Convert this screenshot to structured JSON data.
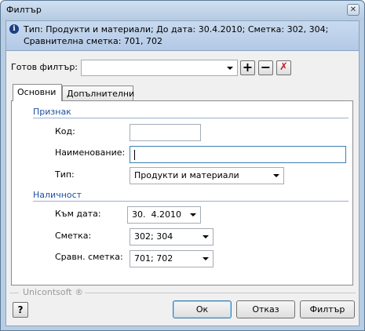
{
  "window": {
    "title": "Филтър",
    "close_glyph": "✕"
  },
  "info": {
    "icon": "i",
    "text": "Тип: Продукти и материали; До дата: 30.4.2010; Сметка: 302, 304; Сравнителна сметка: 701, 702"
  },
  "ready_filter": {
    "label": "Готов филтър:",
    "value": ""
  },
  "toolbar": {
    "add_glyph": "+",
    "remove_glyph": "−",
    "clear_glyph": "✗"
  },
  "tabs": [
    {
      "label": "Основни",
      "active": true
    },
    {
      "label": "Допълнителни",
      "active": false
    }
  ],
  "group_attribute": {
    "header": "Признак",
    "code_label": "Код:",
    "code_value": "",
    "name_label": "Наименование:",
    "name_value": "",
    "type_label": "Тип:",
    "type_value": "Продукти и материали"
  },
  "group_availability": {
    "header": "Наличност",
    "date_label": "Към дата:",
    "date_value": "30.  4.2010",
    "account_label": "Сметка:",
    "account_value": "302; 304",
    "compare_label": "Сравн. сметка:",
    "compare_value": "701; 702"
  },
  "footer": {
    "brand": "Unicontsoft ®",
    "help_glyph": "?",
    "ok_label": "Ок",
    "cancel_label": "Отказ",
    "filter_label": "Филтър"
  }
}
